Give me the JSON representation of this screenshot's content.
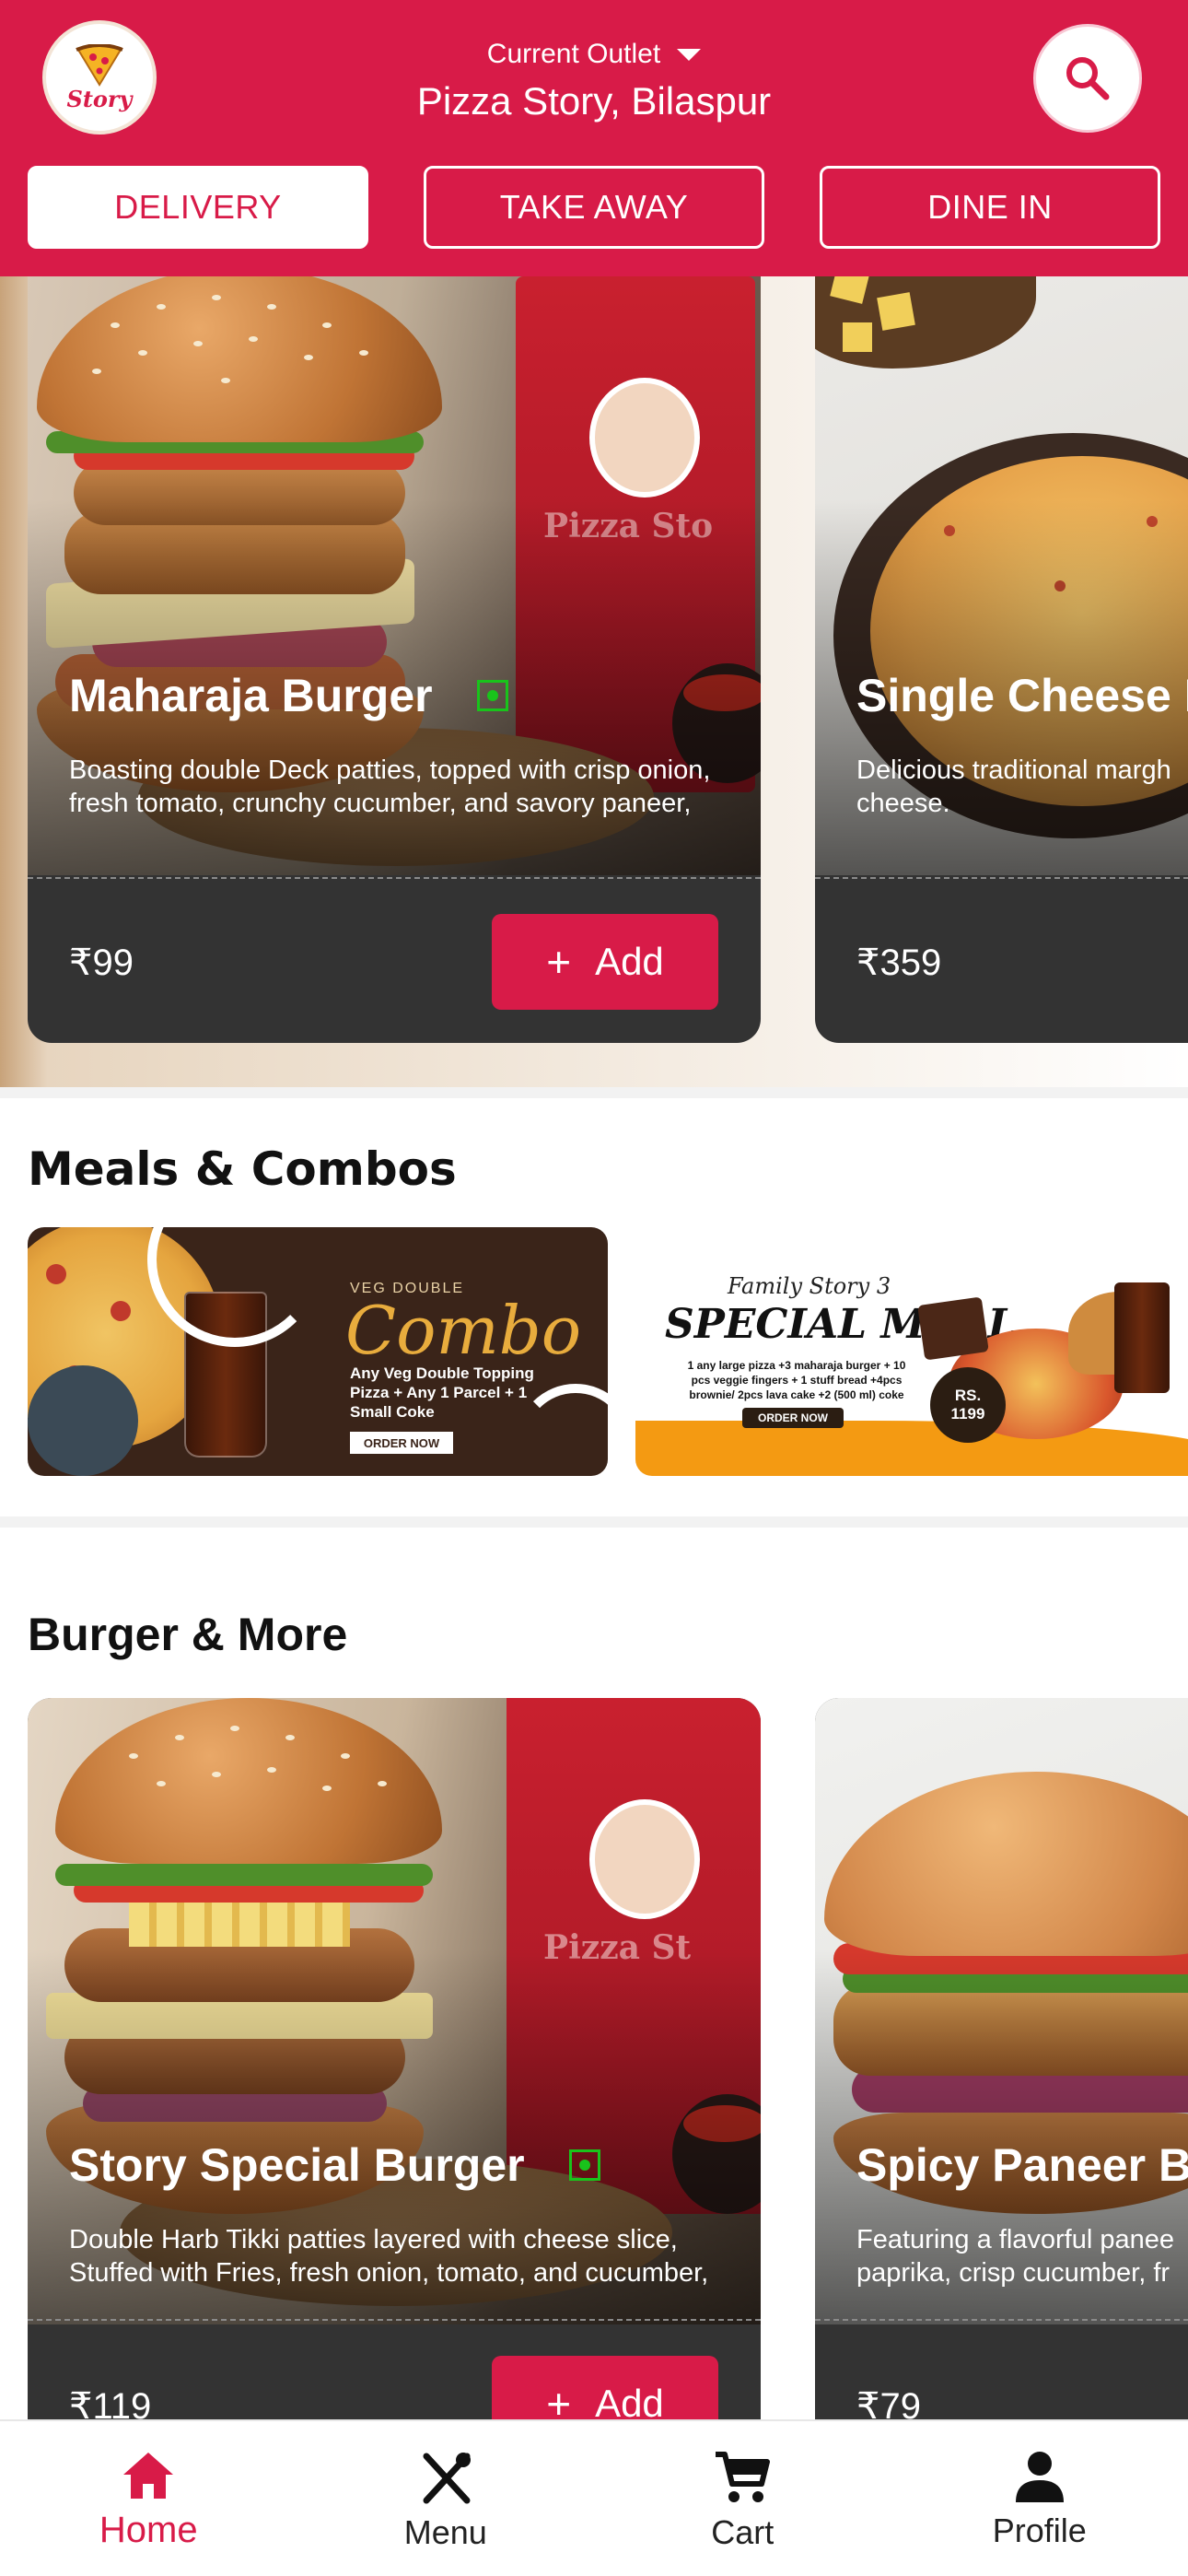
{
  "header": {
    "logo_text": "Story",
    "outlet_label": "Current Outlet",
    "outlet_name": "Pizza Story, Bilaspur",
    "bg_color": "#d81b48"
  },
  "order_tabs": [
    {
      "label": "DELIVERY",
      "active": true
    },
    {
      "label": "TAKE AWAY",
      "active": false
    },
    {
      "label": "DINE IN",
      "active": false
    }
  ],
  "featured": [
    {
      "name": "Maharaja Burger",
      "veg": true,
      "description": "Boasting double Deck patties, topped with crisp onion,\nfresh tomato, crunchy cucumber, and savory paneer,",
      "price": "₹99",
      "add_label": "Add"
    },
    {
      "name": "Single Cheese M",
      "description": "Delicious traditional margh\ncheese.",
      "price": "₹359"
    }
  ],
  "meals_section": {
    "title": "Meals & Combos",
    "banners": [
      {
        "script_top": "VEG DOUBLE",
        "script_big": "Combo",
        "text": "Any Veg Double Topping\nPizza + Any 1 Parcel + 1\nSmall Coke",
        "cta": "ORDER NOW"
      },
      {
        "script_top": "Family Story 3",
        "script_big": "SPECIAL MEAL",
        "text": "1 any large pizza +3 maharaja burger + 10\npcs veggie fingers + 1 stuff bread +4pcs\nbrownie/ 2pcs lava cake +2 (500 ml) coke",
        "cta": "ORDER NOW",
        "price_line1": "RS.",
        "price_line2": "1199"
      }
    ]
  },
  "burger_section": {
    "title": "Burger & More",
    "items": [
      {
        "name": "Story Special Burger",
        "veg": true,
        "description": "Double Harb Tikki patties layered with cheese slice,\nStuffed with Fries, fresh onion, tomato, and cucumber,",
        "price": "₹119",
        "add_label": "Add"
      },
      {
        "name": "Spicy Paneer Bu",
        "description": "Featuring a flavorful panee\npaprika, crisp cucumber, fr",
        "price": "₹79"
      }
    ]
  },
  "bottom_nav": [
    {
      "label": "Home",
      "icon": "home-icon",
      "active": true
    },
    {
      "label": "Menu",
      "icon": "fork-knife-icon",
      "active": false
    },
    {
      "label": "Cart",
      "icon": "cart-icon",
      "active": false
    },
    {
      "label": "Profile",
      "icon": "person-icon",
      "active": false
    }
  ]
}
